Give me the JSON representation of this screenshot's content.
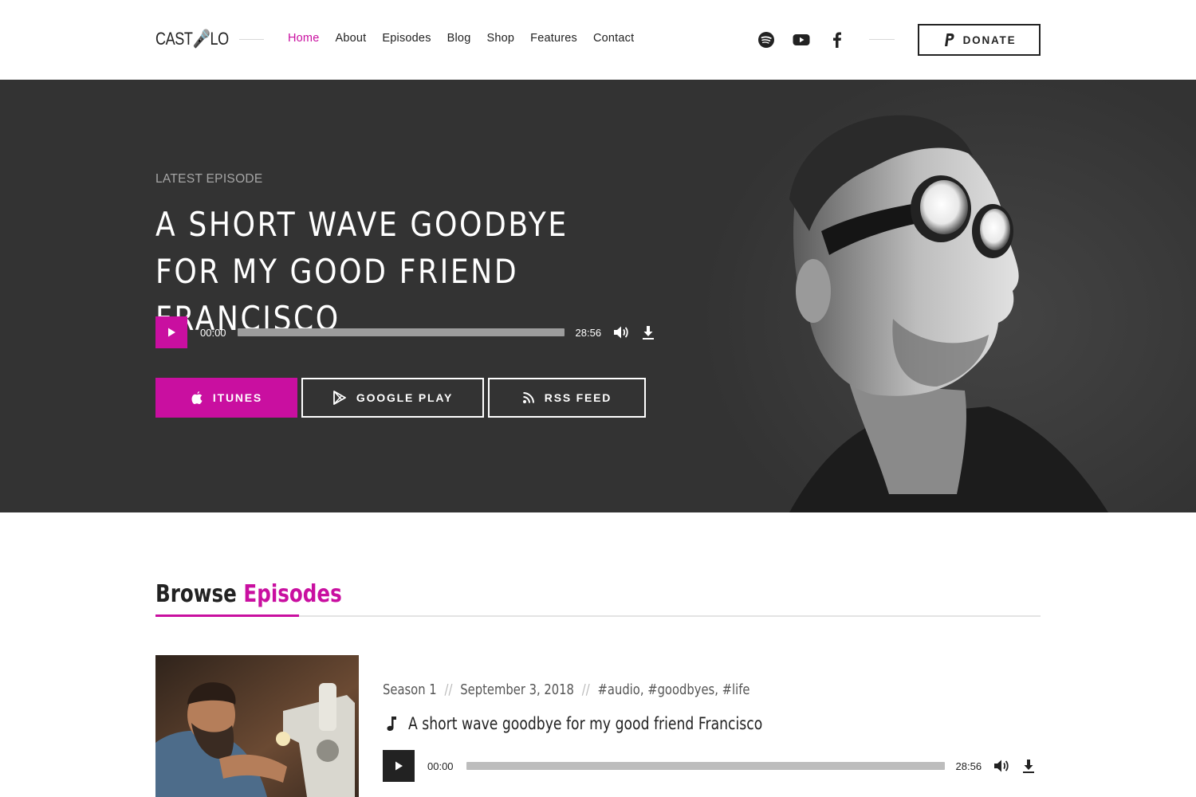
{
  "header": {
    "logo_left": "CAST",
    "logo_right": "LO",
    "nav": [
      "Home",
      "About",
      "Episodes",
      "Blog",
      "Shop",
      "Features",
      "Contact"
    ],
    "social_icons": [
      "spotify-icon",
      "youtube-icon",
      "facebook-icon"
    ],
    "donate_label": "DONATE"
  },
  "hero": {
    "eyebrow": "LATEST EPISODE",
    "title": "A SHORT WAVE GOODBYE FOR MY GOOD FRIEND FRANCISCO",
    "player": {
      "current": "00:00",
      "duration": "28:56",
      "progress": 0
    },
    "buttons": {
      "itunes": "ITUNES",
      "google_play": "GOOGLE PLAY",
      "rss": "RSS FEED"
    }
  },
  "browse": {
    "title_plain": "Browse",
    "title_accent": "Episodes",
    "episode": {
      "season": "Season 1",
      "date": "September 3, 2018",
      "tags": "#audio, #goodbyes, #life",
      "title": "A short wave goodbye for my good friend Francisco",
      "player": {
        "current": "00:00",
        "duration": "28:56",
        "progress": 0
      }
    }
  },
  "colors": {
    "accent": "#c90fa0",
    "hero_bg": "#333333",
    "text": "#222222"
  }
}
